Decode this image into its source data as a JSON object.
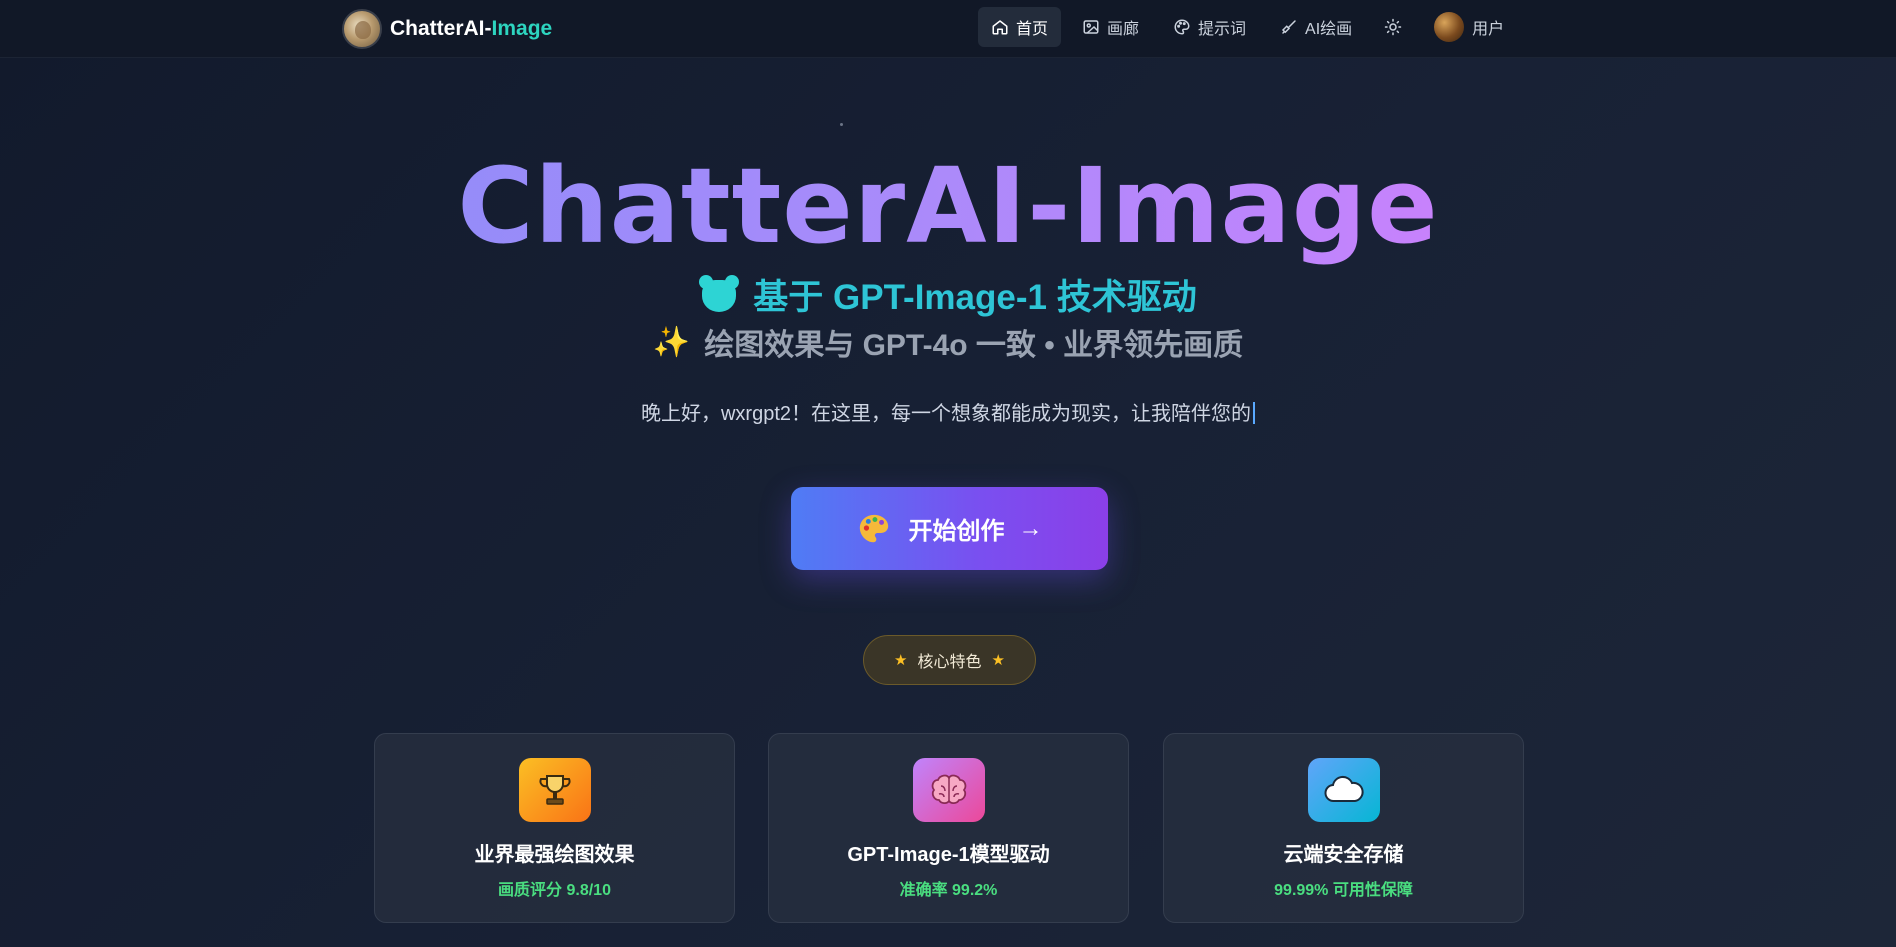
{
  "nav": {
    "brand_prefix": "ChatterAI-",
    "brand_suffix": "Image",
    "items": [
      {
        "label": "首页",
        "icon": "home-icon"
      },
      {
        "label": "画廊",
        "icon": "image-icon"
      },
      {
        "label": "提示词",
        "icon": "palette-icon"
      },
      {
        "label": "AI绘画",
        "icon": "brush-icon"
      }
    ],
    "theme_icon": "sun-icon",
    "user_label": "用户"
  },
  "hero": {
    "title": "ChatterAI-Image",
    "subtitle1": "基于 GPT-Image-1 技术驱动",
    "subtitle2": "绘图效果与 GPT-4o 一致 • 业界领先画质",
    "sparkle_glyph": "✨",
    "greeting": "晚上好，wxrgpt2！在这里，每一个想象都能成为现实，让我陪伴您的",
    "cta_label": "开始创作",
    "cta_arrow": "→"
  },
  "features": {
    "badge_label": "核心特色",
    "star_glyph": "★",
    "cards": [
      {
        "title": "业界最强绘图效果",
        "stat": "画质评分 9.8/10",
        "icon": "trophy-icon",
        "color_from": "#fbbf24",
        "color_to": "#f97316"
      },
      {
        "title": "GPT-Image-1模型驱动",
        "stat": "准确率 99.2%",
        "icon": "brain-icon",
        "color_from": "#c084fc",
        "color_to": "#ec4899"
      },
      {
        "title": "云端安全存储",
        "stat": "99.99% 可用性保障",
        "icon": "cloud-icon",
        "color_from": "#60a5fa",
        "color_to": "#06b6d4"
      }
    ]
  },
  "colors": {
    "accent_teal": "#2dd4bf",
    "stat_green": "#4ade80",
    "cta_from": "#4f7cf5",
    "cta_to": "#8b3fe8"
  }
}
